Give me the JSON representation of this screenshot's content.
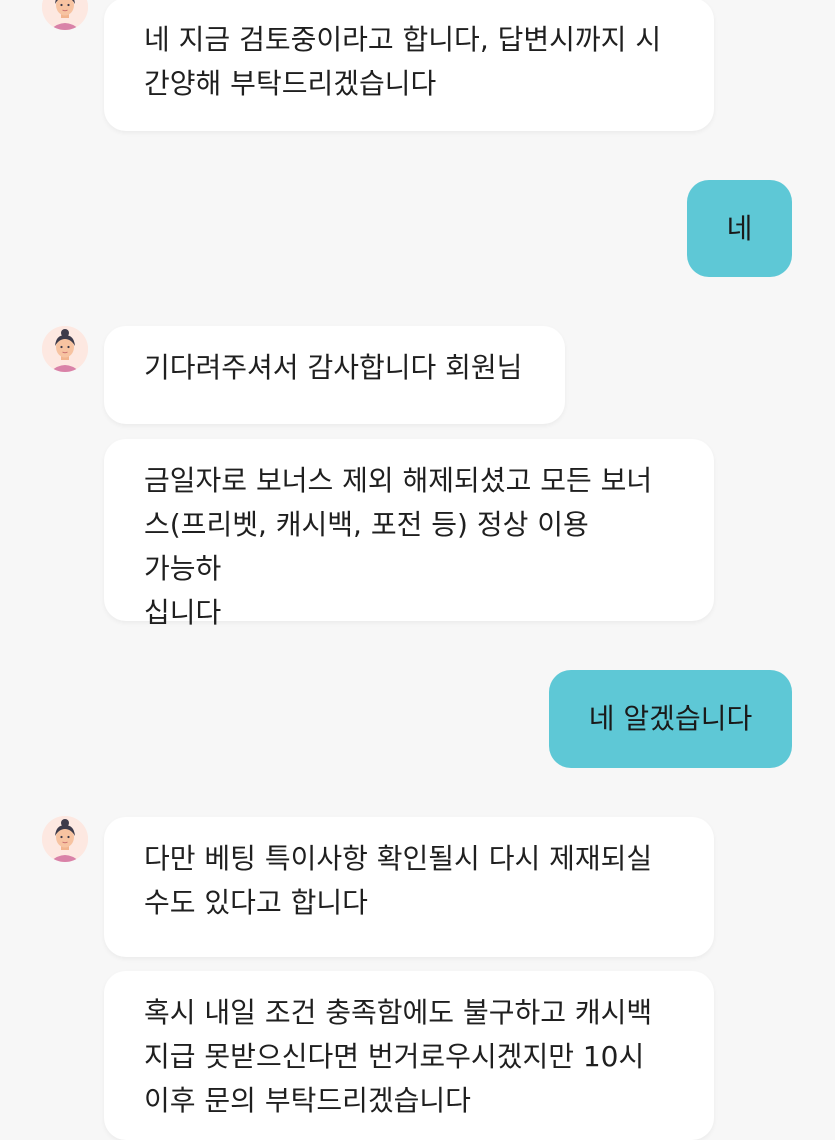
{
  "colors": {
    "background": "#f7f7f7",
    "agent_bubble": "#ffffff",
    "user_bubble": "#5ec8d6"
  },
  "messages": [
    {
      "sender": "agent",
      "avatar": "agent-avatar-icon",
      "text": "네 지금 검토중이라고 합니다, 답변시까지 시\n간양해 부탁드리겠습니다"
    },
    {
      "sender": "user",
      "text": "네"
    },
    {
      "sender": "agent",
      "avatar": "agent-avatar-icon",
      "text": "기다려주셔서 감사합니다 회원님"
    },
    {
      "sender": "agent",
      "text": "금일자로 보너스 제외 해제되셨고 모든 보너\n스(프리벳, 캐시백, 포전 등) 정상 이용 가능하\n십니다"
    },
    {
      "sender": "user",
      "text": "네 알겠습니다"
    },
    {
      "sender": "agent",
      "avatar": "agent-avatar-icon",
      "text": "다만 베팅 특이사항 확인될시 다시 제재되실\n수도 있다고 합니다"
    },
    {
      "sender": "agent",
      "text": "혹시 내일 조건 충족함에도 불구하고 캐시백\n지급 못받으신다면 번거로우시겠지만 10시\n이후 문의 부탁드리겠습니다"
    }
  ]
}
